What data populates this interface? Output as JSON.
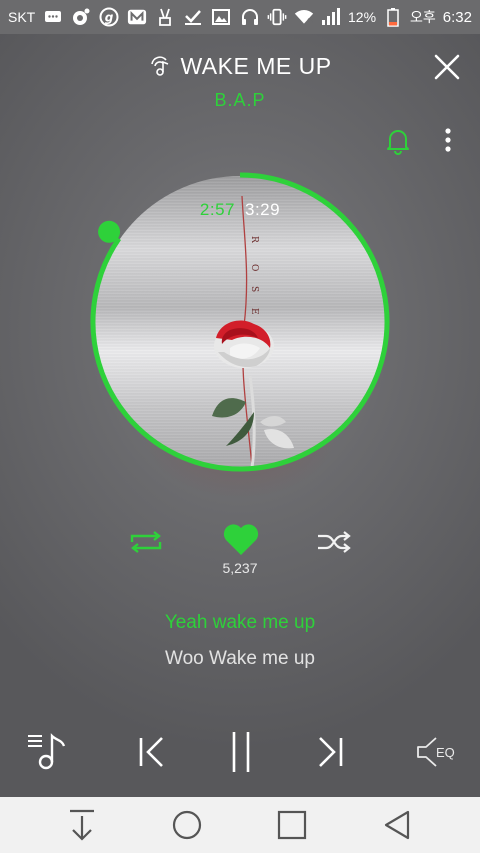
{
  "status_bar": {
    "carrier": "SKT",
    "battery_percent": "12%",
    "ampm": "오후",
    "time": "6:32",
    "icons": [
      "message-icon",
      "record-icon",
      "g-app-icon",
      "m-app-icon",
      "victory-icon",
      "check-icon",
      "image-icon",
      "headphones-icon",
      "vibrate-icon",
      "wifi-icon",
      "signal-icon",
      "battery-icon"
    ]
  },
  "header": {
    "title": "WAKE ME UP",
    "artist": "B.A.P"
  },
  "player": {
    "elapsed": "2:57",
    "total": "3:29",
    "progress_fraction": 0.846,
    "like_count": "5,237"
  },
  "lyrics": {
    "current": "Yeah wake me up",
    "next": "Woo Wake me up"
  },
  "controls": {
    "eq_label": "EQ"
  },
  "colors": {
    "accent": "#2ed13a",
    "background": "#5e5e60",
    "nav_bar": "#f1f1f1"
  }
}
